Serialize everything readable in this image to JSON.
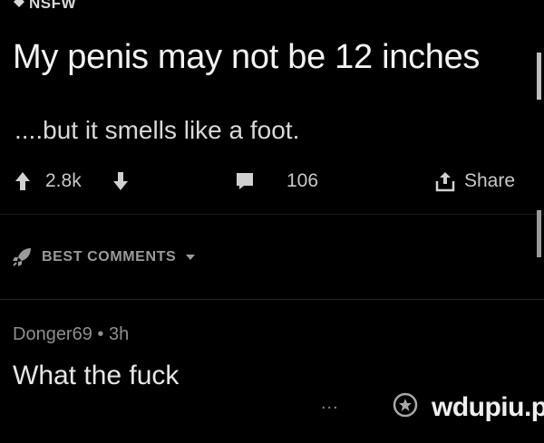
{
  "post": {
    "tag": "NSFW",
    "title": "My penis may not be 12 inches",
    "body": "....but it smells like a foot."
  },
  "actions": {
    "score": "2.8k",
    "comments": "106",
    "share_label": "Share"
  },
  "sort": {
    "label": "BEST COMMENTS"
  },
  "comment": {
    "meta": "Donger69 • 3h",
    "text": "What the fuck",
    "more": "..."
  },
  "watermark": "wdupiu.pl",
  "colors": {
    "background": "#000000",
    "text": "#eaeaea",
    "muted": "#8e8e8e"
  },
  "icons": [
    "nsfw-icon",
    "upvote-icon",
    "downvote-icon",
    "comment-icon",
    "share-icon",
    "rocket-icon",
    "sort-chevron-icon",
    "award-icon"
  ]
}
